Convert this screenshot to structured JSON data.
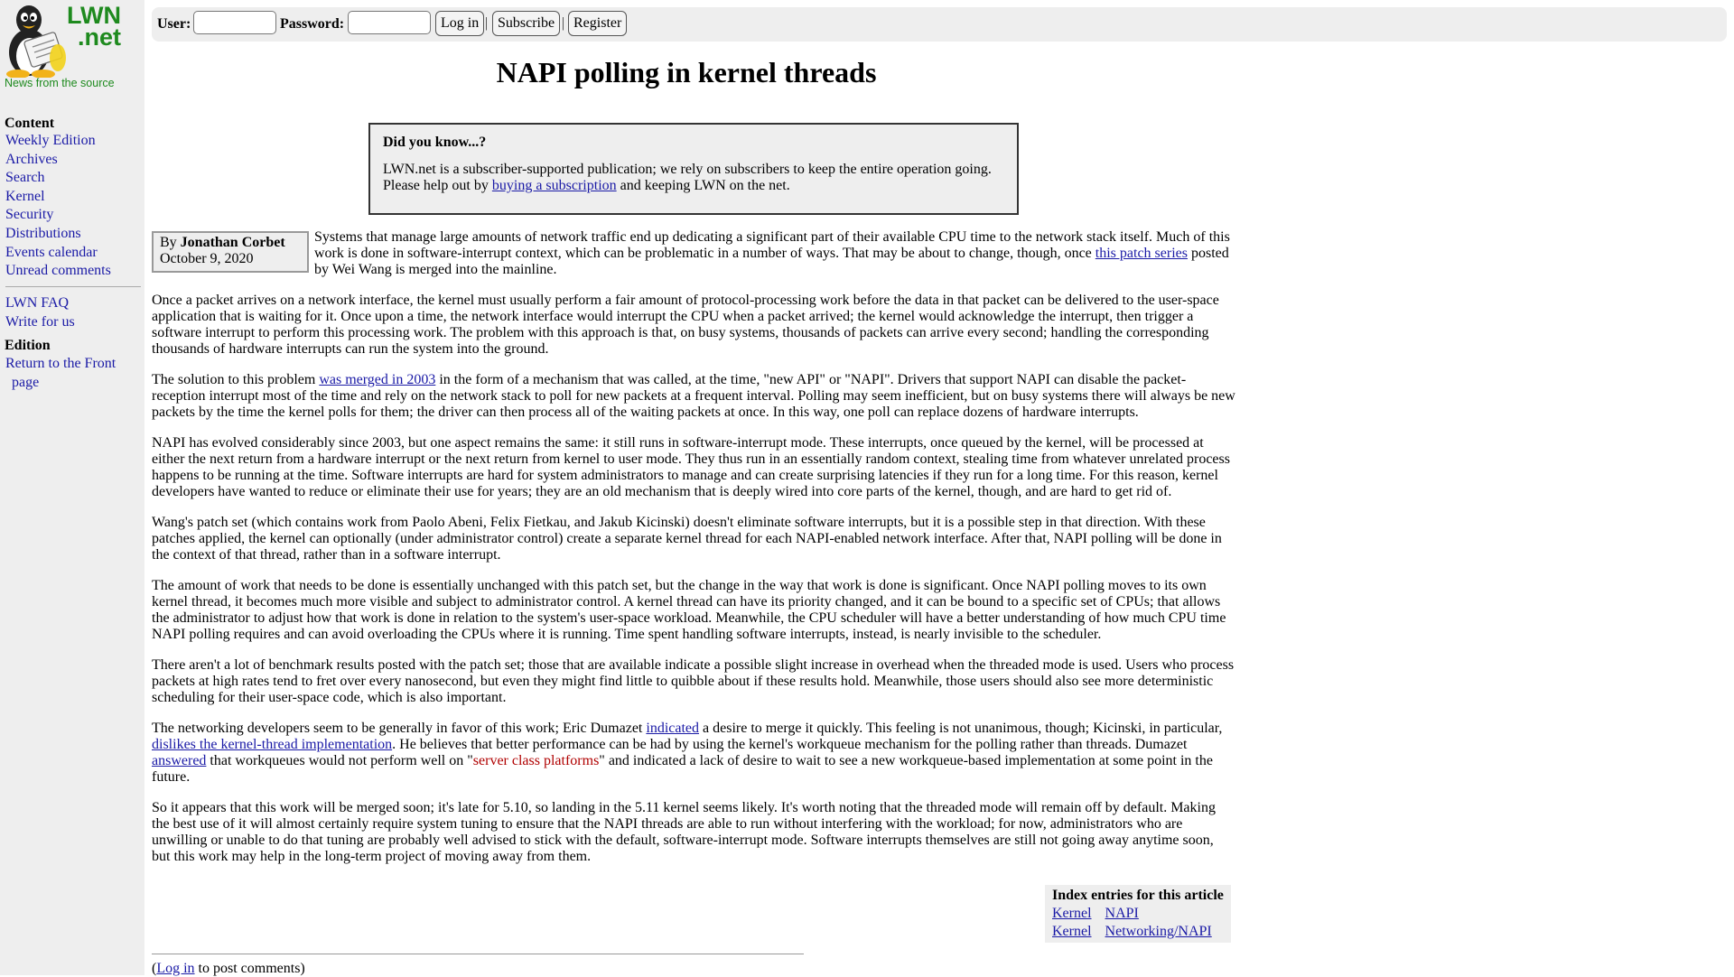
{
  "sidebar": {
    "logo_text": [
      "LWN",
      ".net"
    ],
    "tagline": "News from the source",
    "content_heading": "Content",
    "content_items": [
      "Weekly Edition",
      "Archives",
      "Search",
      "Kernel",
      "Security",
      "Distributions",
      "Events calendar",
      "Unread comments"
    ],
    "extra_items": [
      "LWN FAQ",
      "Write for us"
    ],
    "edition_heading": "Edition",
    "edition_items": [
      "Return to the Front",
      "page"
    ]
  },
  "login": {
    "user_label": "User:",
    "password_label": "Password:",
    "user_value": "",
    "password_value": "",
    "login_button": "Log in",
    "subscribe_button": "Subscribe",
    "register_button": "Register",
    "separator": "|"
  },
  "article": {
    "title": "NAPI polling in kernel threads",
    "did_you_know": {
      "heading": "Did you know...?",
      "text_before": "LWN.net is a subscriber-supported publication; we rely on subscribers to keep the entire operation going. Please help out by ",
      "link": "buying a subscription",
      "text_after": " and keeping LWN on the net."
    },
    "byline": {
      "by": "By ",
      "author": "Jonathan Corbet",
      "date": "October 9, 2020"
    },
    "lead": {
      "before": "Systems that manage large amounts of network traffic end up dedicating a significant part of their available CPU time to the network stack itself. Much of this work is done in software-interrupt context, which can be problematic in a number of ways. That may be about to change, though, once ",
      "link": "this patch series",
      "after": " posted by Wei Wang is merged into the mainline."
    },
    "p1": "Once a packet arrives on a network interface, the kernel must usually perform a fair amount of protocol-processing work before the data in that packet can be delivered to the user-space application that is waiting for it. Once upon a time, the network interface would interrupt the CPU when a packet arrived; the kernel would acknowledge the interrupt, then trigger a software interrupt to perform this processing work. The problem with this approach is that, on busy systems, thousands of packets can arrive every second; handling the corresponding thousands of hardware interrupts can run the system into the ground.",
    "p2": {
      "before": "The solution to this problem ",
      "link": "was merged in 2003",
      "after": " in the form of a mechanism that was called, at the time, \"new API\" or \"NAPI\". Drivers that support NAPI can disable the packet-reception interrupt most of the time and rely on the network stack to poll for new packets at a frequent interval. Polling may seem inefficient, but on busy systems there will always be new packets by the time the kernel polls for them; the driver can then process all of the waiting packets at once. In this way, one poll can replace dozens of hardware interrupts."
    },
    "p3": "NAPI has evolved considerably since 2003, but one aspect remains the same: it still runs in software-interrupt mode. These interrupts, once queued by the kernel, will be processed at either the next return from a hardware interrupt or the next return from kernel to user mode. They thus run in an essentially random context, stealing time from whatever unrelated process happens to be running at the time. Software interrupts are hard for system administrators to manage and can create surprising latencies if they run for a long time. For this reason, kernel developers have wanted to reduce or eliminate their use for years; they are an old mechanism that is deeply wired into core parts of the kernel, though, and are hard to get rid of.",
    "p4": "Wang's patch set (which contains work from Paolo Abeni, Felix Fietkau, and Jakub Kicinski) doesn't eliminate software interrupts, but it is a possible step in that direction. With these patches applied, the kernel can optionally (under administrator control) create a separate kernel thread for each NAPI-enabled network interface. After that, NAPI polling will be done in the context of that thread, rather than in a software interrupt.",
    "p5": "The amount of work that needs to be done is essentially unchanged with this patch set, but the change in the way that work is done is significant. Once NAPI polling moves to its own kernel thread, it becomes much more visible and subject to administrator control. A kernel thread can have its priority changed, and it can be bound to a specific set of CPUs; that allows the administrator to adjust how that work is done in relation to the system's user-space workload. Meanwhile, the CPU scheduler will have a better understanding of how much CPU time NAPI polling requires and can avoid overloading the CPUs where it is running. Time spent handling software interrupts, instead, is nearly invisible to the scheduler.",
    "p6": "There aren't a lot of benchmark results posted with the patch set; those that are available indicate a possible slight increase in overhead when the threaded mode is used. Users who process packets at high rates tend to fret over every nanosecond, but even they might find little to quibble about if these results hold. Meanwhile, those users should also see more deterministic scheduling for their user-space code, which is also important.",
    "p7": {
      "t1": "The networking developers seem to be generally in favor of this work; Eric Dumazet ",
      "l1": "indicated",
      "t2": " a desire to merge it quickly. This feeling is not unanimous, though; Kicinski, in particular, ",
      "l2": "dislikes the kernel-thread implementation",
      "t3": ". He believes that better performance can be had by using the kernel's workqueue mechanism for the polling rather than threads. Dumazet ",
      "l3": "answered",
      "t4": " that workqueues would not perform well on \"",
      "quote": "server class platforms",
      "t5": "\" and indicated a lack of desire to wait to see a new workqueue-based implementation at some point in the future."
    },
    "p8": "So it appears that this work will be merged soon; it's late for 5.10, so landing in the 5.11 kernel seems likely. It's worth noting that the threaded mode will remain off by default. Making the best use of it will almost certainly require system tuning to ensure that the NAPI threads are able to run without interfering with the workload; for now, administrators who are unwilling or unable to do that tuning are probably well advised to stick with the default, software-interrupt mode. Software interrupts themselves are still not going away anytime soon, but this work may help in the long-term project of moving away from them.",
    "index": {
      "title": "Index entries for this article",
      "rows": [
        [
          "Kernel",
          "NAPI"
        ],
        [
          "Kernel",
          "Networking/NAPI"
        ]
      ]
    },
    "comment_note": {
      "open": "(",
      "link": "Log in",
      "close": " to post comments)"
    }
  },
  "colors": {
    "sidebar_bg": "#eeeeee",
    "logo_green": "#1e8a1e",
    "link": "#1a1aa6",
    "quote_red": "#b00000"
  }
}
